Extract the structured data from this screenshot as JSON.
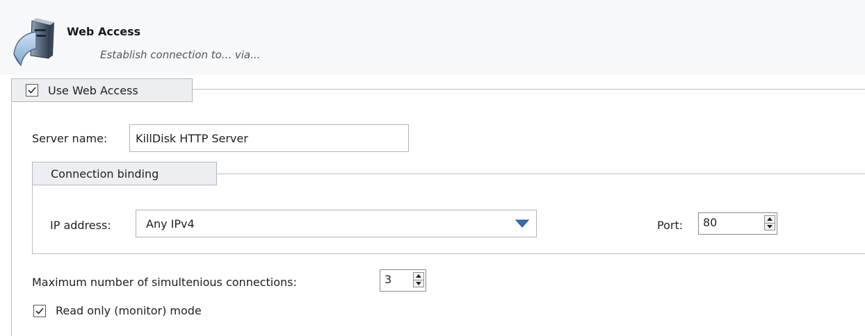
{
  "header": {
    "title": "Web Access",
    "subtitle": "Establish connection to... via..."
  },
  "web_access_group": {
    "checkbox_label": "Use Web Access",
    "checked": true
  },
  "server": {
    "label": "Server name:",
    "value": "KillDisk HTTP Server"
  },
  "connection_binding": {
    "title": "Connection binding",
    "ip_label": "IP address:",
    "ip_value": "Any IPv4",
    "port_label": "Port:",
    "port_value": "80"
  },
  "max_connections": {
    "label": "Maximum number of simultenious connections:",
    "value": "3"
  },
  "read_only": {
    "label": "Read only (monitor) mode",
    "checked": true
  },
  "colors": {
    "header_bg": "#f7f8fa",
    "tab_bg": "#eceef1",
    "dropdown_arrow": "#2f6fb3"
  }
}
